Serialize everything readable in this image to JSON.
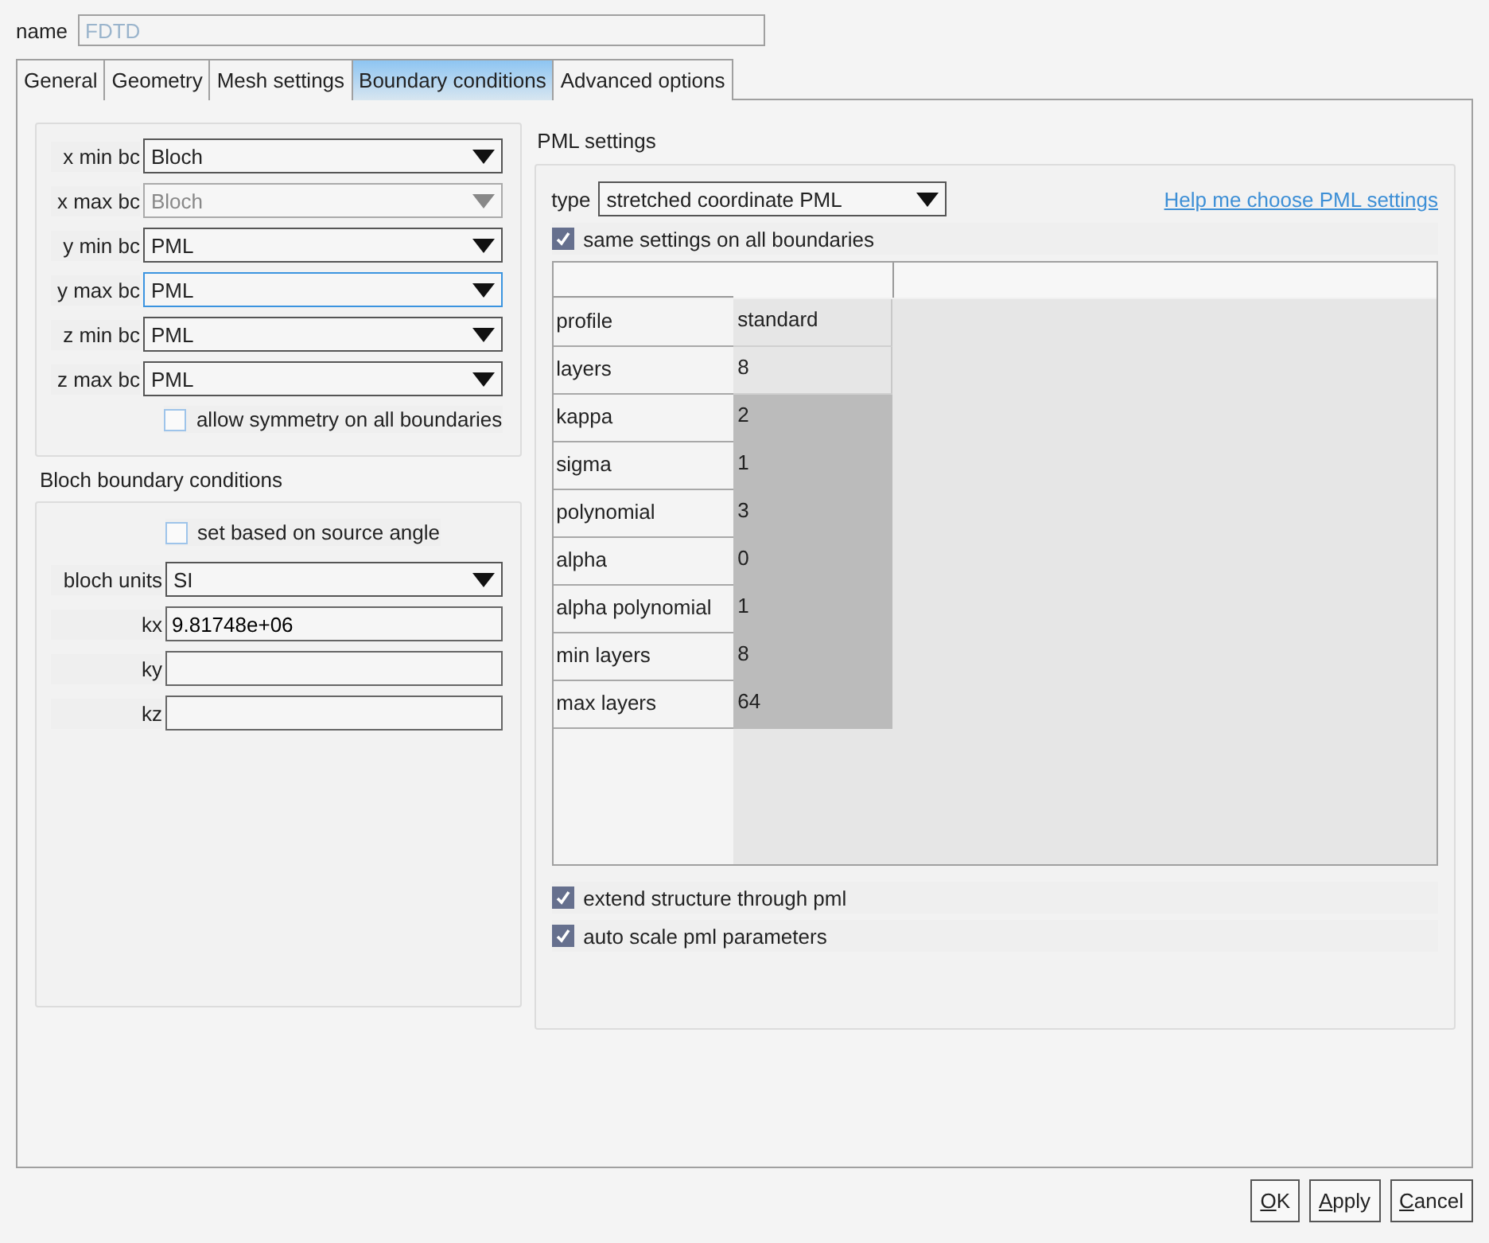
{
  "name_field": {
    "label": "name",
    "placeholder": "FDTD"
  },
  "tabs": [
    {
      "label": "General",
      "selected": false
    },
    {
      "label": "Geometry",
      "selected": false
    },
    {
      "label": "Mesh settings",
      "selected": false
    },
    {
      "label": "Boundary conditions",
      "selected": true
    },
    {
      "label": "Advanced options",
      "selected": false
    }
  ],
  "boundaries": {
    "rows": [
      {
        "label": "x min bc",
        "value": "Bloch",
        "disabled": false,
        "focused": false
      },
      {
        "label": "x max bc",
        "value": "Bloch",
        "disabled": true,
        "focused": false
      },
      {
        "label": "y min bc",
        "value": "PML",
        "disabled": false,
        "focused": false
      },
      {
        "label": "y max bc",
        "value": "PML",
        "disabled": false,
        "focused": true
      },
      {
        "label": "z min bc",
        "value": "PML",
        "disabled": false,
        "focused": false
      },
      {
        "label": "z max bc",
        "value": "PML",
        "disabled": false,
        "focused": false
      }
    ],
    "symmetry": {
      "label": "allow symmetry on all boundaries",
      "checked": false
    }
  },
  "bloch": {
    "title": "Bloch boundary conditions",
    "source_angle": {
      "label": "set based on source angle",
      "checked": false
    },
    "units": {
      "label": "bloch units",
      "value": "SI"
    },
    "fields": [
      {
        "label": "kx",
        "value": "9.81748e+06"
      },
      {
        "label": "ky"
      },
      {
        "label": "kz"
      }
    ]
  },
  "pml": {
    "title": "PML settings",
    "type": {
      "label": "type",
      "value": "stretched coordinate PML"
    },
    "help_link": "Help me choose PML settings",
    "same_settings": {
      "label": "same settings on all boundaries",
      "checked": true
    },
    "rows": [
      {
        "label": "profile",
        "value": "standard",
        "editable": true
      },
      {
        "label": "layers",
        "value": "8",
        "editable": true
      },
      {
        "label": "kappa",
        "value": "2",
        "editable": false
      },
      {
        "label": "sigma",
        "value": "1",
        "editable": false
      },
      {
        "label": "polynomial",
        "value": "3",
        "editable": false
      },
      {
        "label": "alpha",
        "value": "0",
        "editable": false
      },
      {
        "label": "alpha polynomial",
        "value": "1",
        "editable": false
      },
      {
        "label": "min layers",
        "value": "8",
        "editable": false
      },
      {
        "label": "max layers",
        "value": "64",
        "editable": false
      }
    ],
    "options": [
      {
        "label": "extend structure through pml",
        "checked": true
      },
      {
        "label": "auto scale pml parameters",
        "checked": true
      }
    ]
  },
  "buttons": [
    {
      "mnemonic": "O",
      "rest": "K"
    },
    {
      "mnemonic": "A",
      "rest": "pply"
    },
    {
      "mnemonic": "C",
      "rest": "ancel"
    }
  ]
}
